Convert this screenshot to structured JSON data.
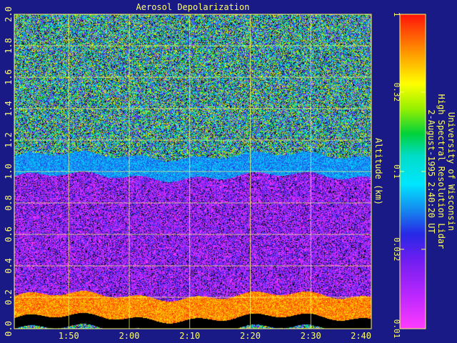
{
  "chart_data": {
    "type": "heatmap",
    "title": "Aerosol Depolarization",
    "xlabel": "",
    "ylabel": "Altitude (km)",
    "x_tick_labels": [
      "1:50",
      "2:00",
      "2:10",
      "2:20",
      "2:30",
      "2:40"
    ],
    "y_tick_labels": [
      "0.0",
      "0.2",
      "0.4",
      "0.6",
      "0.8",
      "1.0",
      "1.2",
      "1.4",
      "1.6",
      "1.8",
      "2.0"
    ],
    "y_ticks": [
      0.0,
      0.2,
      0.4,
      0.6,
      0.8,
      1.0,
      1.2,
      1.4,
      1.6,
      1.8,
      2.0
    ],
    "ylim": [
      0.0,
      2.0
    ],
    "x_ticks_minutes": [
      110,
      120,
      130,
      140,
      150,
      160
    ],
    "xlim_minutes": [
      101,
      160
    ],
    "grid": true,
    "colorbar": {
      "scale": "log",
      "range": [
        0.01,
        1
      ],
      "tick_labels": [
        "1",
        "0.32",
        "0.1",
        "0.032",
        "0.01"
      ],
      "tick_values": [
        1,
        0.32,
        0.1,
        0.032,
        0.01
      ]
    },
    "layers": [
      {
        "name": "surface_gap",
        "altitude_range_km": [
          0.0,
          0.07
        ],
        "depolarization": null
      },
      {
        "name": "near_field_high",
        "altitude_range_km": [
          0.07,
          0.21
        ],
        "depolarization": 0.6
      },
      {
        "name": "boundary_layer",
        "altitude_range_km": [
          0.21,
          0.97
        ],
        "depolarization": 0.02
      },
      {
        "name": "layer_top",
        "altitude_range_km": [
          0.97,
          1.1
        ],
        "depolarization": 0.06
      },
      {
        "name": "free_troposphere_noise",
        "altitude_range_km": [
          1.1,
          2.0
        ],
        "depolarization": 0.1
      }
    ]
  },
  "annotation": {
    "line1": "University of Wisconsin",
    "line2": "High Spectral Resolution Lidar",
    "line3": "2-August-1995  2:40:20 UT"
  },
  "colors": {
    "background": "#1a1a86",
    "axis": "#ffff66",
    "grid": "#ffff66"
  }
}
